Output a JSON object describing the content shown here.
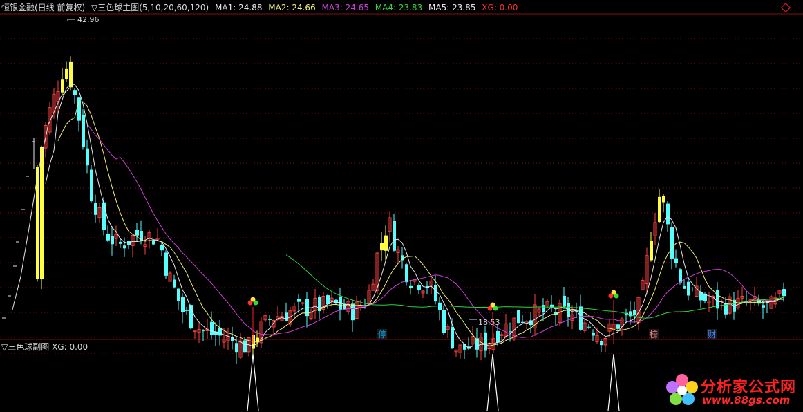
{
  "header": {
    "title": "恒银金融(日线 前复权)",
    "indicator": "▽三色球主图(5,10,20,60,120)",
    "ma": [
      {
        "label": "MA1: 24.88",
        "color": "#e6e6e6"
      },
      {
        "label": "MA2: 24.66",
        "color": "#f0f07a"
      },
      {
        "label": "MA3: 24.65",
        "color": "#d040d8"
      },
      {
        "label": "MA4: 23.83",
        "color": "#30d040"
      },
      {
        "label": "MA5: 23.85",
        "color": "#e6e6e6"
      },
      {
        "label": "XG: 0.00",
        "color": "#ff3030"
      }
    ]
  },
  "sub_panel": {
    "title": "▽三色球副图",
    "xg": "XG: 0.00"
  },
  "annotations": {
    "high": "42.96",
    "low": "18.53"
  },
  "markers": [
    {
      "text": "停",
      "color": "#00a0e0"
    },
    {
      "text": "榜",
      "color": "#ff8080"
    },
    {
      "text": "财",
      "color": "#4080ff"
    }
  ],
  "watermark": {
    "line1": "分析家公式网",
    "line2": "www.88gs.com"
  },
  "colors": {
    "up": "#ff4040",
    "down": "#54ffff",
    "signal": "#ffff40",
    "grid": "#801010"
  },
  "chart_data": {
    "type": "candlestick",
    "high": 42.96,
    "low": 18.53,
    "signal_peaks": 3,
    "series": [
      {
        "name": "MA1",
        "value": 24.88
      },
      {
        "name": "MA2",
        "value": 24.66
      },
      {
        "name": "MA3",
        "value": 24.65
      },
      {
        "name": "MA4",
        "value": 23.83
      },
      {
        "name": "MA5",
        "value": 23.85
      },
      {
        "name": "XG",
        "value": 0.0
      }
    ]
  }
}
